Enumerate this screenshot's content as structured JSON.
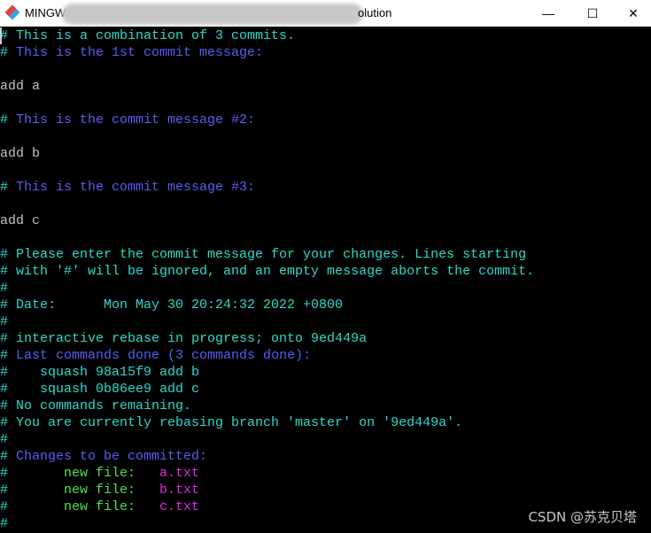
{
  "window": {
    "title_prefix": "MINGW",
    "title_suffix": "olution",
    "minimize": "—",
    "maximize": "☐",
    "close": "✕"
  },
  "colors": {
    "c": "#2fd9c9",
    "b": "#5a5cf2",
    "w": "#c0c0c0",
    "g": "#4ee04e",
    "m": "#e028e0"
  },
  "lines": [
    [
      {
        "t": "# This is a combination of 3 commits.",
        "c": "c"
      }
    ],
    [
      {
        "t": "# ",
        "c": "c"
      },
      {
        "t": "This is the 1st commit message:",
        "c": "b"
      }
    ],
    [],
    [
      {
        "t": "add a",
        "c": "w"
      }
    ],
    [],
    [
      {
        "t": "# ",
        "c": "c"
      },
      {
        "t": "This is the commit message #2:",
        "c": "b"
      }
    ],
    [],
    [
      {
        "t": "add b",
        "c": "w"
      }
    ],
    [],
    [
      {
        "t": "# ",
        "c": "c"
      },
      {
        "t": "This is the commit message #3:",
        "c": "b"
      }
    ],
    [],
    [
      {
        "t": "add c",
        "c": "w"
      }
    ],
    [],
    [
      {
        "t": "# Please enter the commit message for your changes. Lines starting",
        "c": "c"
      }
    ],
    [
      {
        "t": "# with '#' will be ignored, and an empty message aborts the commit.",
        "c": "c"
      }
    ],
    [
      {
        "t": "#",
        "c": "c"
      }
    ],
    [
      {
        "t": "# Date:      Mon May 30 20:24:32 2022 +0800",
        "c": "c"
      }
    ],
    [
      {
        "t": "#",
        "c": "c"
      }
    ],
    [
      {
        "t": "# interactive rebase in progress; onto 9ed449a",
        "c": "c"
      }
    ],
    [
      {
        "t": "# ",
        "c": "c"
      },
      {
        "t": "Last commands done (3 commands done):",
        "c": "b"
      }
    ],
    [
      {
        "t": "#    squash 98a15f9 add b",
        "c": "c"
      }
    ],
    [
      {
        "t": "#    squash 0b86ee9 add c",
        "c": "c"
      }
    ],
    [
      {
        "t": "# No commands remaining.",
        "c": "c"
      }
    ],
    [
      {
        "t": "# You are currently rebasing branch 'master' on '9ed449a'.",
        "c": "c"
      }
    ],
    [
      {
        "t": "#",
        "c": "c"
      }
    ],
    [
      {
        "t": "# ",
        "c": "c"
      },
      {
        "t": "Changes to be committed:",
        "c": "b"
      }
    ],
    [
      {
        "t": "#       ",
        "c": "c"
      },
      {
        "t": "new file:   ",
        "c": "g"
      },
      {
        "t": "a.txt",
        "c": "m"
      }
    ],
    [
      {
        "t": "#       ",
        "c": "c"
      },
      {
        "t": "new file:   ",
        "c": "g"
      },
      {
        "t": "b.txt",
        "c": "m"
      }
    ],
    [
      {
        "t": "#       ",
        "c": "c"
      },
      {
        "t": "new file:   ",
        "c": "g"
      },
      {
        "t": "c.txt",
        "c": "m"
      }
    ],
    [
      {
        "t": "#",
        "c": "c"
      }
    ]
  ],
  "watermark": "CSDN @苏克贝塔"
}
